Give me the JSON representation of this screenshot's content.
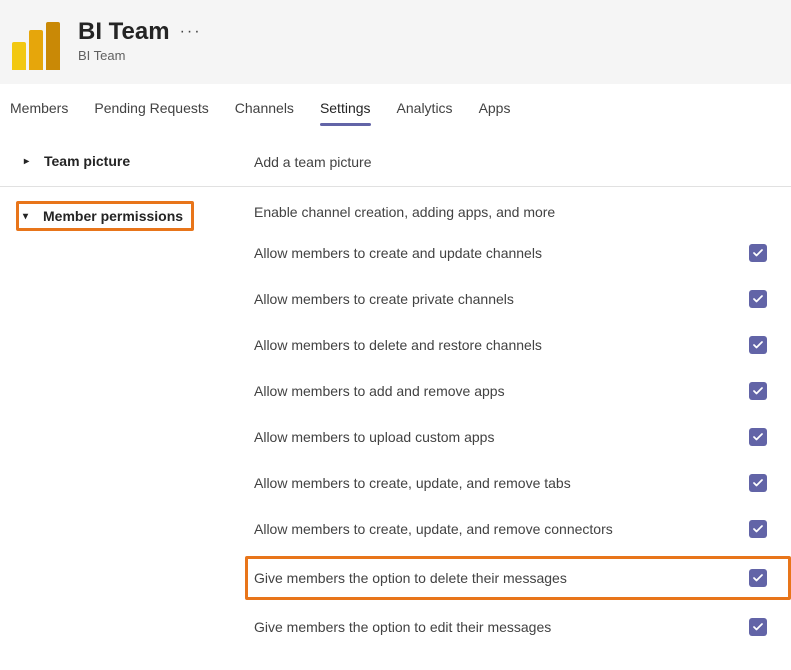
{
  "header": {
    "title": "BI Team",
    "subtitle": "BI Team"
  },
  "tabs": [
    {
      "label": "Members",
      "active": false
    },
    {
      "label": "Pending Requests",
      "active": false
    },
    {
      "label": "Channels",
      "active": false
    },
    {
      "label": "Settings",
      "active": true
    },
    {
      "label": "Analytics",
      "active": false
    },
    {
      "label": "Apps",
      "active": false
    }
  ],
  "sections": {
    "team_picture": {
      "label": "Team picture",
      "desc": "Add a team picture"
    },
    "member_permissions": {
      "label": "Member permissions",
      "desc": "Enable channel creation, adding apps, and more",
      "items": [
        {
          "label": "Allow members to create and update channels",
          "checked": true,
          "hl": false
        },
        {
          "label": "Allow members to create private channels",
          "checked": true,
          "hl": false
        },
        {
          "label": "Allow members to delete and restore channels",
          "checked": true,
          "hl": false
        },
        {
          "label": "Allow members to add and remove apps",
          "checked": true,
          "hl": false
        },
        {
          "label": "Allow members to upload custom apps",
          "checked": true,
          "hl": false
        },
        {
          "label": "Allow members to create, update, and remove tabs",
          "checked": true,
          "hl": false
        },
        {
          "label": "Allow members to create, update, and remove connectors",
          "checked": true,
          "hl": false
        },
        {
          "label": "Give members the option to delete their messages",
          "checked": true,
          "hl": true
        },
        {
          "label": "Give members the option to edit their messages",
          "checked": true,
          "hl": false
        }
      ]
    }
  }
}
